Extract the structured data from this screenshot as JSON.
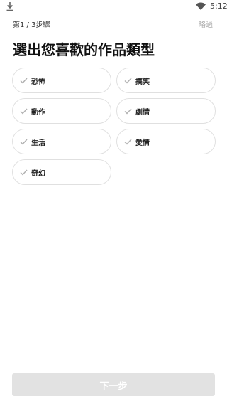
{
  "status_bar": {
    "time": "5:12",
    "left_icon": "download-icon",
    "right_icon": "wifi-icon"
  },
  "header": {
    "step_text": "第1 / 3步驟",
    "skip_label": "略過"
  },
  "title": "選出您喜歡的作品類型",
  "genres": [
    {
      "label": "恐怖",
      "icon": "check-icon"
    },
    {
      "label": "搞笑",
      "icon": "check-icon"
    },
    {
      "label": "動作",
      "icon": "check-icon"
    },
    {
      "label": "劇情",
      "icon": "check-icon"
    },
    {
      "label": "生活",
      "icon": "check-icon"
    },
    {
      "label": "愛情",
      "icon": "check-icon"
    },
    {
      "label": "奇幻",
      "icon": "check-icon"
    }
  ],
  "footer": {
    "next_label": "下一步"
  },
  "colors": {
    "chip_border": "#e0e0e0",
    "check_mark": "#b0b0b0",
    "next_button_disabled": "#e2e2e2",
    "skip_text": "#aaaaaa"
  }
}
